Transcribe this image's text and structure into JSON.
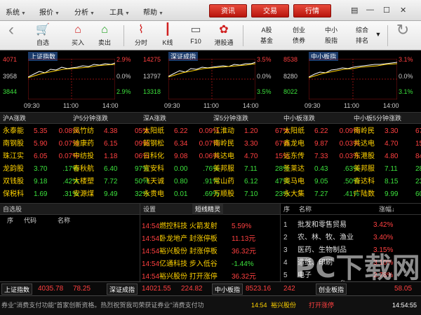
{
  "menu": [
    {
      "label": "系统"
    },
    {
      "label": "报价"
    },
    {
      "label": "分析"
    },
    {
      "label": "工具"
    },
    {
      "label": "帮助"
    }
  ],
  "top_buttons": [
    "资讯",
    "交易",
    "行情"
  ],
  "toolbar": {
    "items": [
      "自选",
      "买入",
      "卖出",
      "分时",
      "K线",
      "F10",
      "港股通"
    ],
    "text_items": [
      {
        "line1": "A股",
        "line2": "基金"
      },
      {
        "line1": "创业",
        "line2": "债券"
      },
      {
        "line1": "中小",
        "line2": "股指"
      },
      {
        "line1": "综合",
        "line2": "排名"
      }
    ]
  },
  "charts": [
    {
      "title": "上证指数",
      "high": "4071",
      "mid": "3958",
      "low": "3844",
      "up_pct": "2.9%",
      "zero_pct": "0.0%",
      "down_pct": "2.9%",
      "times": [
        "09:30",
        "11:00",
        "14:00"
      ]
    },
    {
      "title": "深证成指",
      "high": "14275",
      "mid": "13797",
      "low": "13318",
      "up_pct": "3.5%",
      "zero_pct": "0.0%",
      "down_pct": "3.5%",
      "times": [
        "09:30",
        "11:00",
        "14:00"
      ]
    },
    {
      "title": "中小板指",
      "high": "8538",
      "mid": "8280",
      "low": "8022",
      "up_pct": "3.1%",
      "zero_pct": "0.0%",
      "down_pct": "3.1%",
      "times": [
        "09:30",
        "11:00",
        "14:00"
      ]
    }
  ],
  "rank_heads": [
    "沪A涨跌",
    "沪5分钟涨跌",
    "深A涨跌",
    "深5分钟涨跌",
    "中小板涨跌",
    "中小板5分钟涨跌"
  ],
  "rank_cols": [
    [
      {
        "n": "永泰能",
        "p": "5.35",
        "c": "0.08%",
        "u": true
      },
      {
        "n": "南钢股",
        "p": "5.90",
        "c": "0.07%",
        "u": true
      },
      {
        "n": "珠江实",
        "p": "6.05",
        "c": "0.07%",
        "u": true
      },
      {
        "n": "龙韵股",
        "p": "3.70",
        "c": ".17%",
        "u": false
      },
      {
        "n": "双钱股",
        "p": "9.18",
        "c": ".42%",
        "u": false
      },
      {
        "n": "保税科",
        "p": "1.69",
        "c": ".31%",
        "u": false
      }
    ],
    [
      {
        "n": "凤竹纺",
        "p": "4.38",
        "c": "05%",
        "u": true
      },
      {
        "n": "迪康药",
        "p": "6.15",
        "c": "09%",
        "u": true
      },
      {
        "n": "中纺投",
        "p": "1.18",
        "c": "06%",
        "u": true
      },
      {
        "n": "春秋航",
        "p": "6.40",
        "c": "97%",
        "u": false
      },
      {
        "n": "大楼塑",
        "p": "7.72",
        "c": "50%",
        "u": false
      },
      {
        "n": "安源煤",
        "p": "9.49",
        "c": "32%",
        "u": false
      }
    ],
    [
      {
        "n": "太阳纸",
        "p": "6.22",
        "c": "0.09%",
        "u": true
      },
      {
        "n": "韶钢松",
        "p": "6.34",
        "c": "0.07%",
        "u": true
      },
      {
        "n": "日科化",
        "p": "9.08",
        "c": "0.06%",
        "u": true
      },
      {
        "n": "宜安科",
        "p": "0.00",
        "c": ".76%",
        "u": false
      },
      {
        "n": "飞天诚",
        "p": "0.80",
        "c": ".91%",
        "u": false
      },
      {
        "n": "永贵电",
        "p": "0.01",
        "c": ".69%",
        "u": false
      }
    ],
    [
      {
        "n": "江淮动",
        "p": "1.20",
        "c": "67%",
        "u": true
      },
      {
        "n": "南岭民",
        "p": "3.30",
        "c": "67%",
        "u": true
      },
      {
        "n": "共达电",
        "p": "4.70",
        "c": "15%",
        "u": true
      },
      {
        "n": "美邦服",
        "p": "7.11",
        "c": "28%",
        "u": false
      },
      {
        "n": "常山药",
        "p": "6.12",
        "c": "47%",
        "u": false
      },
      {
        "n": "万顺股",
        "p": "7.10",
        "c": "23%",
        "u": false
      }
    ],
    [
      {
        "n": "太阳纸",
        "p": "6.22",
        "c": "0.09%",
        "u": true
      },
      {
        "n": "鑫龙电",
        "p": "9.87",
        "c": "0.03%",
        "u": true
      },
      {
        "n": "远东传",
        "p": "7.33",
        "c": "0.03%",
        "u": true
      },
      {
        "n": "圣莱达",
        "p": "0.43",
        "c": ".63%",
        "u": false
      },
      {
        "n": "奥马电",
        "p": "9.05",
        "c": ".50%",
        "u": false
      },
      {
        "n": "永大集",
        "p": "7.27",
        "c": ".41%",
        "u": false
      }
    ],
    [
      {
        "n": "南岭民",
        "p": "3.30",
        "c": "67%",
        "u": true
      },
      {
        "n": "共达电",
        "p": "4.70",
        "c": "15%",
        "u": true
      },
      {
        "n": "东港股",
        "p": "4.80",
        "c": "84%",
        "u": true
      },
      {
        "n": "美邦服",
        "p": "7.11",
        "c": "28%",
        "u": false
      },
      {
        "n": "奋达科",
        "p": "8.15",
        "c": "23%",
        "u": false
      },
      {
        "n": "广陆数",
        "p": "9.99",
        "c": "60%",
        "u": false
      }
    ]
  ],
  "watchlist": {
    "tab": "自选股",
    "cols": [
      "序",
      "代码",
      "名称"
    ]
  },
  "news": {
    "tab_left": "设置",
    "tab": "短线精灵",
    "items": [
      {
        "t": "14:54",
        "s": "燃控科技",
        "e": "火箭发射",
        "v": "5.59%",
        "up": true
      },
      {
        "t": "14:54",
        "s": "卧龙地产",
        "e": "封涨停板",
        "v": "11.13元",
        "up": true
      },
      {
        "t": "14:54",
        "s": "裕兴股份",
        "e": "封涨停板",
        "v": "36.32元",
        "up": true
      },
      {
        "t": "14:54",
        "s": "亿通科技",
        "e": "步入低谷",
        "v": "-1.44%",
        "up": false
      },
      {
        "t": "14:54",
        "s": "裕兴股份",
        "e": "打开涨停",
        "v": "36.32元",
        "up": true
      }
    ]
  },
  "sectors": {
    "cols": [
      "序",
      "名称",
      "涨幅↓"
    ],
    "items": [
      {
        "no": "1",
        "name": "批发和零售贸易",
        "v": "3.42%"
      },
      {
        "no": "2",
        "name": "农、林、牧、渔业",
        "v": "3.40%"
      },
      {
        "no": "3",
        "name": "医药、生物制品",
        "v": "3.15%"
      },
      {
        "no": "4",
        "name": "造纸、印刷",
        "v": "3.10%"
      },
      {
        "no": "5",
        "name": "电子",
        "v": "2.78%"
      }
    ]
  },
  "status": {
    "sh_label": "上证指数",
    "sh_val": "4035.78",
    "sh_chg": "78.25",
    "sz_label": "深证成指",
    "sz_val": "14021.55",
    "sz_chg": "224.82",
    "zx_label": "中小板指",
    "zx_val": "8523.16",
    "zx_chg": "242",
    "cy_label": "创业板指",
    "cy_chg": "58.05"
  },
  "ticker": {
    "text": "券业\"消费支付功能\"首家创新资格。热烈祝贺我司荣获证券业\"消费支付功",
    "hl_time": "14:54",
    "hl_stock": "裕兴股份",
    "hl_event": "打开涨停",
    "clock": "14:54:55"
  },
  "watermark": {
    "big": "PC下载网",
    "url": "www.pcsoft.com.cn"
  },
  "colors": {
    "up": "#ff4040",
    "down": "#3ce03c",
    "name": "#ffd200",
    "accent": "#c8160c"
  }
}
